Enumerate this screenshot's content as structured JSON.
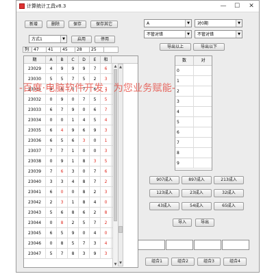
{
  "window": {
    "title": "计算统计工具v8.3",
    "controls": {
      "minimize": "—",
      "maximize": "☐",
      "close": "✕"
    }
  },
  "toolbar": {
    "add": "新增",
    "delete": "删除",
    "save": "保存",
    "save_other": "保存其它"
  },
  "scheme": {
    "selected": "方式1",
    "enable": "启用",
    "disable": "停用"
  },
  "filter_row": [
    "列",
    "47",
    "41",
    "45",
    "28",
    "25",
    ""
  ],
  "table": {
    "headers": [
      "期",
      "A",
      "B",
      "C",
      "D",
      "E",
      "和"
    ],
    "rows": [
      {
        "id": "23029",
        "cells": [
          "4",
          "9",
          "9",
          "9",
          "7",
          "6"
        ],
        "red": [
          false,
          false,
          false,
          false,
          false,
          true
        ]
      },
      {
        "id": "23030",
        "cells": [
          "5",
          "5",
          "7",
          "5",
          "2",
          "3"
        ],
        "red": [
          false,
          false,
          false,
          false,
          false,
          true
        ]
      },
      {
        "id": "23031",
        "cells": [
          "4",
          "6",
          "0",
          "7",
          "6",
          "7"
        ],
        "red": [
          false,
          false,
          false,
          false,
          false,
          true
        ]
      },
      {
        "id": "23032",
        "cells": [
          "0",
          "9",
          "0",
          "7",
          "5",
          "5"
        ],
        "red": [
          false,
          false,
          false,
          false,
          false,
          true
        ]
      },
      {
        "id": "23033",
        "cells": [
          "6",
          "7",
          "9",
          "0",
          "6",
          "7"
        ],
        "red": [
          false,
          false,
          false,
          false,
          false,
          true
        ]
      },
      {
        "id": "23034",
        "cells": [
          "0",
          "0",
          "1",
          "4",
          "5",
          "4"
        ],
        "red": [
          false,
          false,
          false,
          false,
          false,
          true
        ]
      },
      {
        "id": "23035",
        "cells": [
          "6",
          "4",
          "9",
          "6",
          "9",
          "3"
        ],
        "red": [
          false,
          true,
          false,
          false,
          false,
          true
        ]
      },
      {
        "id": "23036",
        "cells": [
          "6",
          "5",
          "6",
          "3",
          "0",
          "1"
        ],
        "red": [
          false,
          false,
          false,
          true,
          false,
          true
        ]
      },
      {
        "id": "23037",
        "cells": [
          "7",
          "7",
          "1",
          "0",
          "0",
          "3"
        ],
        "red": [
          false,
          false,
          false,
          false,
          false,
          true
        ]
      },
      {
        "id": "23038",
        "cells": [
          "0",
          "9",
          "1",
          "8",
          "3",
          "5"
        ],
        "red": [
          false,
          false,
          false,
          false,
          true,
          true
        ]
      },
      {
        "id": "23039",
        "cells": [
          "7",
          "6",
          "3",
          "0",
          "7",
          "6"
        ],
        "red": [
          false,
          true,
          false,
          false,
          false,
          true
        ]
      },
      {
        "id": "23040",
        "cells": [
          "3",
          "3",
          "4",
          "8",
          "7",
          "2"
        ],
        "red": [
          false,
          false,
          false,
          false,
          false,
          true
        ]
      },
      {
        "id": "23041",
        "cells": [
          "6",
          "0",
          "0",
          "8",
          "2",
          "3"
        ],
        "red": [
          false,
          true,
          false,
          false,
          false,
          true
        ]
      },
      {
        "id": "23042",
        "cells": [
          "2",
          "3",
          "1",
          "8",
          "4",
          "0"
        ],
        "red": [
          false,
          true,
          false,
          false,
          false,
          true
        ]
      },
      {
        "id": "23043",
        "cells": [
          "5",
          "6",
          "8",
          "6",
          "2",
          "8"
        ],
        "red": [
          false,
          false,
          false,
          false,
          false,
          true
        ]
      },
      {
        "id": "23044",
        "cells": [
          "0",
          "8",
          "2",
          "5",
          "7",
          "2"
        ],
        "red": [
          false,
          true,
          false,
          false,
          false,
          true
        ]
      },
      {
        "id": "23045",
        "cells": [
          "6",
          "5",
          "9",
          "0",
          "4",
          "0"
        ],
        "red": [
          false,
          false,
          false,
          false,
          false,
          true
        ]
      },
      {
        "id": "23046",
        "cells": [
          "0",
          "8",
          "5",
          "7",
          "3",
          "4"
        ],
        "red": [
          false,
          false,
          false,
          false,
          false,
          true
        ]
      },
      {
        "id": "23047",
        "cells": [
          "5",
          "7",
          "8",
          "3",
          "9",
          "3"
        ],
        "red": [
          false,
          false,
          false,
          false,
          false,
          true
        ]
      }
    ]
  },
  "right": {
    "combo1": "A",
    "combo2": "对0期",
    "combo3": "不管对错",
    "combo4": "不管对错",
    "export_up": "导出以上",
    "export_down": "导出以下",
    "result_headers": [
      "数",
      "对"
    ],
    "result_rows": [
      "0",
      "1",
      "2",
      "3",
      "4",
      "5",
      "6",
      "7",
      "8",
      "9"
    ],
    "btn_rows": [
      [
        "907成入",
        "897成入",
        "213成入"
      ],
      [
        "123成入",
        "23成入",
        "32成入"
      ],
      [
        "43成入",
        "54成入",
        "65成入"
      ]
    ],
    "import": "导入",
    "export": "导出",
    "groups": [
      "组合1",
      "组合2",
      "组合3",
      "组合4"
    ]
  },
  "watermark": "-百度·电脑软件开发，为您业务赋能-"
}
